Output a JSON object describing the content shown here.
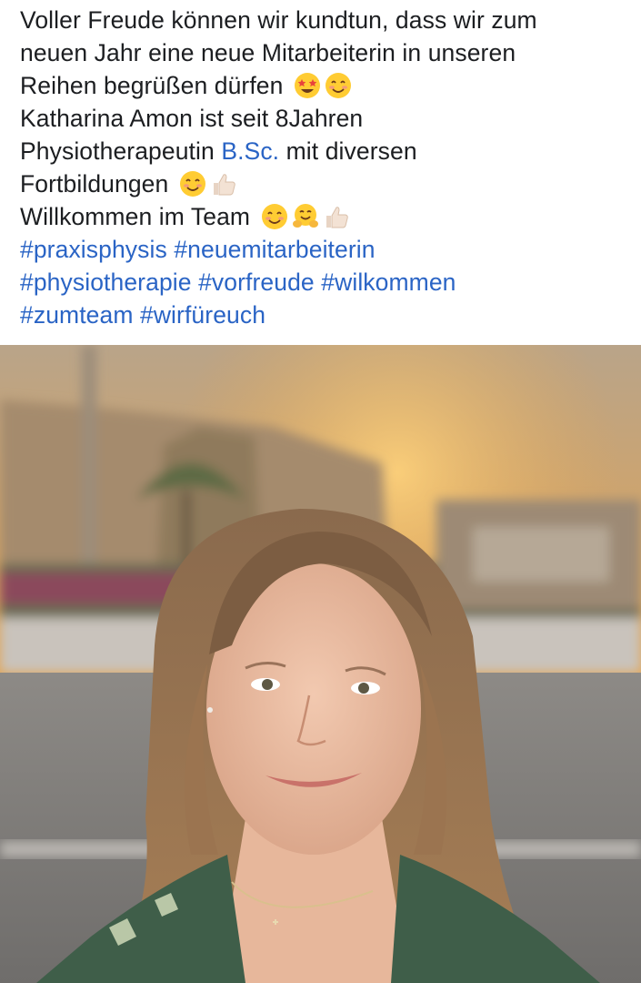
{
  "post": {
    "line1": "Voller Freude können wir kundtun, dass wir zum",
    "line2": "neuen Jahr eine neue Mitarbeiterin in unseren",
    "line3": "Reihen begrüßen dürfen",
    "line4": "Katharina Amon ist seit 8Jahren",
    "line5_pre": "Physiotherapeutin ",
    "line5_link": "B.Sc.",
    "line5_post": " mit diversen",
    "line6": "Fortbildungen",
    "line7": "Willkommen im Team",
    "hashtags": [
      "#praxisphysis",
      "#neuemitarbeiterin",
      "#physiotherapie",
      "#vorfreude",
      "#wilkommen",
      "#zumteam",
      "#wirfüreuch"
    ]
  },
  "emojis": {
    "line3": [
      "star-struck-icon",
      "smiling-face-icon"
    ],
    "line6": [
      "smiling-face-icon",
      "thumbs-up-icon"
    ],
    "line7": [
      "smiling-face-icon",
      "hugging-face-icon",
      "thumbs-up-icon"
    ]
  },
  "colors": {
    "text": "#1c1e21",
    "link": "#2a64c5",
    "sky": "#e9a24c",
    "road": "#7d7b78"
  }
}
